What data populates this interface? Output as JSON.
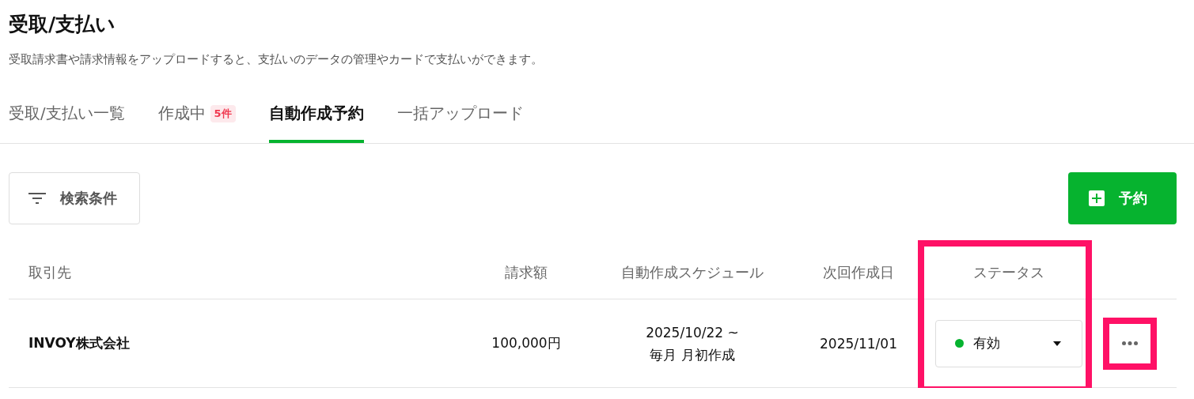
{
  "page": {
    "title": "受取/支払い",
    "description": "受取請求書や請求情報をアップロードすると、支払いのデータの管理やカードで支払いができます。"
  },
  "tabs": [
    {
      "label": "受取/支払い一覧",
      "selected": false
    },
    {
      "label": "作成中",
      "badge": "5件",
      "selected": false
    },
    {
      "label": "自動作成予約",
      "selected": true
    },
    {
      "label": "一括アップロード",
      "selected": false
    }
  ],
  "toolbar": {
    "filter_button": "検索条件",
    "add_button": "予約"
  },
  "table": {
    "columns": [
      {
        "label": "取引先",
        "highlighted": false
      },
      {
        "label": "請求額",
        "highlighted": false
      },
      {
        "label": "自動作成スケジュール",
        "highlighted": false
      },
      {
        "label": "次回作成日",
        "highlighted": false
      },
      {
        "label": "ステータス",
        "highlighted": true
      }
    ],
    "rows": [
      {
        "partner": "INVOY株式会社",
        "amount": "100,000円",
        "schedule": [
          "2025/10/22 ~",
          "毎月 月初作成"
        ],
        "next_date": "2025/11/01",
        "status": {
          "label": "有効",
          "color": "#06b32f"
        },
        "menu_highlighted": true
      }
    ]
  }
}
